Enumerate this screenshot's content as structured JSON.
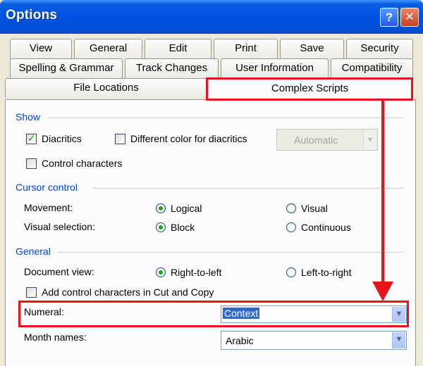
{
  "window": {
    "title": "Options",
    "help_glyph": "?",
    "close_glyph": "✕"
  },
  "tabs": {
    "row1": [
      "View",
      "General",
      "Edit",
      "Print",
      "Save",
      "Security"
    ],
    "row2": [
      "Spelling & Grammar",
      "Track Changes",
      "User Information",
      "Compatibility"
    ],
    "row3": [
      "File Locations",
      "Complex Scripts"
    ],
    "active": "Complex Scripts"
  },
  "show": {
    "group_label": "Show",
    "diacritics_label": "Diacritics",
    "diacritics_checked": true,
    "different_color_label": "Different color for diacritics",
    "different_color_checked": false,
    "color_value": "Automatic",
    "control_chars_label": "Control characters",
    "control_chars_checked": false
  },
  "cursor": {
    "group_label": "Cursor control",
    "movement_label": "Movement:",
    "movement_options": [
      "Logical",
      "Visual"
    ],
    "movement_selected": "Logical",
    "visual_selection_label": "Visual selection:",
    "visual_selection_options": [
      "Block",
      "Continuous"
    ],
    "visual_selection_selected": "Block"
  },
  "general": {
    "group_label": "General",
    "document_view_label": "Document view:",
    "document_view_options": [
      "Right-to-left",
      "Left-to-right"
    ],
    "document_view_selected": "Right-to-left",
    "add_control_label": "Add control characters in Cut and Copy",
    "add_control_checked": false,
    "numeral_label": "Numeral:",
    "numeral_value": "Context",
    "month_names_label": "Month names:",
    "month_names_value": "Arabic"
  },
  "colors": {
    "group_label": "#0046d5",
    "highlight": "#e8141a",
    "selection": "#316ac5",
    "titlebar": "#0054e3"
  },
  "icons": [
    "help-icon",
    "close-icon",
    "check-icon",
    "chevron-down-icon"
  ]
}
